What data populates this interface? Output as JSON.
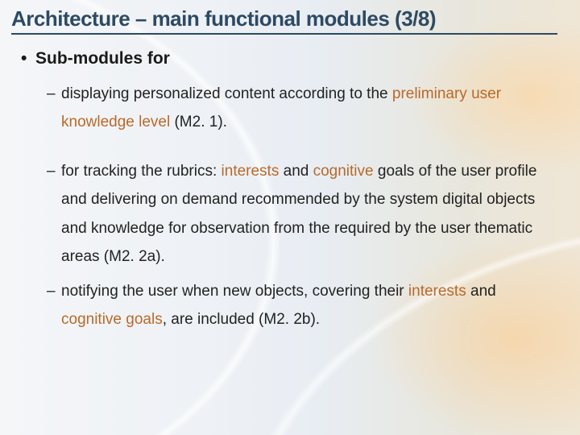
{
  "title": "Architecture – main functional modules (3/8)",
  "bullet_char": "•",
  "dash_char": "–",
  "lvl1": {
    "text": "Sub-modules for"
  },
  "items": [
    {
      "parts": [
        {
          "t": "displaying personalized content according to the "
        },
        {
          "t": "preliminary user knowledge level",
          "hl": true
        },
        {
          "t": " (M2. 1)."
        }
      ]
    },
    {
      "parts": [
        {
          "t": "for tracking the rubrics: "
        },
        {
          "t": "interests",
          "hl": true
        },
        {
          "t": " and "
        },
        {
          "t": "cognitive",
          "hl": true
        },
        {
          "t": " goals of the user profile and delivering on demand recommended by the system digital objects and knowledge for observation from the required by the user thematic areas (M2. 2a)."
        }
      ]
    },
    {
      "parts": [
        {
          "t": "notifying the user when new objects, covering their "
        },
        {
          "t": "interests",
          "hl": true
        },
        {
          "t": " and "
        },
        {
          "t": "cognitive goals",
          "hl": true
        },
        {
          "t": ", are included (M2. 2b)."
        }
      ]
    }
  ]
}
